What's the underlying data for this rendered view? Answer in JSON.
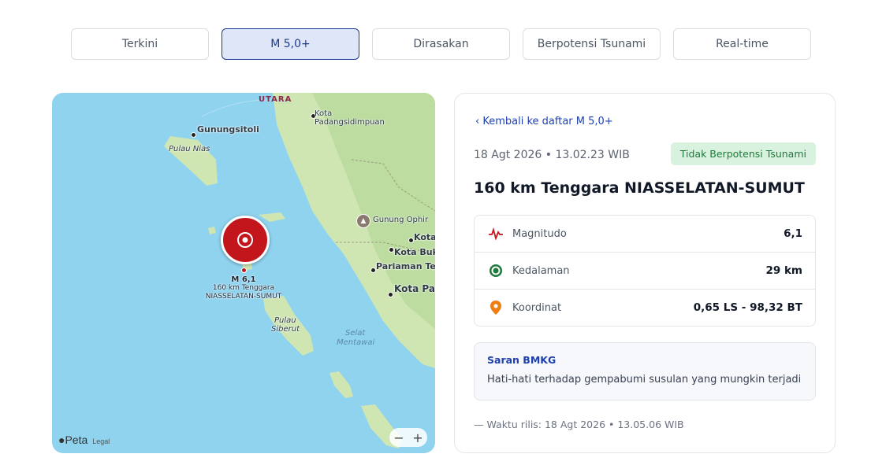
{
  "tabs": [
    {
      "label": "Terkini",
      "active": false
    },
    {
      "label": "M 5,0+",
      "active": true
    },
    {
      "label": "Dirasakan",
      "active": false
    },
    {
      "label": "Berpotensi Tsunami",
      "active": false
    },
    {
      "label": "Real-time",
      "active": false
    }
  ],
  "map": {
    "compass": "UTARA",
    "places": {
      "gunungsitoli": "Gunungsitoli",
      "pulau_nias": "Pulau Nias",
      "padangsidimpuan_1": "Kota",
      "padangsidimpuan_2": "Padangsidimpuan",
      "gunung_ophir": "Gunung Ophir",
      "kota": "Kota",
      "kota_buki": "Kota Buki",
      "pariaman": "Pariaman Teng",
      "kota_pad": "Kota Pad",
      "pulau_siberut_1": "Pulau",
      "pulau_siberut_2": "Siberut",
      "selat_1": "Selat",
      "selat_2": "Mentawai"
    },
    "marker": {
      "magnitude_label": "M 6,1",
      "line1": "160 km Tenggara",
      "line2": "NIASSELATAN-SUMUT"
    },
    "brand": "Peta",
    "legal": "Legal",
    "zoom_out": "−",
    "zoom_in": "+"
  },
  "detail": {
    "back_label": "Kembali ke daftar M 5,0+",
    "datetime": "18 Agt 2026 • 13.02.23 WIB",
    "tsunami_badge": "Tidak Berpotensi Tsunami",
    "title": "160 km Tenggara NIASSELATAN-SUMUT",
    "rows": [
      {
        "icon": "waveform-icon",
        "label": "Magnitudo",
        "value": "6,1"
      },
      {
        "icon": "depth-target-icon",
        "label": "Kedalaman",
        "value": "29 km"
      },
      {
        "icon": "location-pin-icon",
        "label": "Koordinat",
        "value": "0,65 LS - 98,32 BT"
      }
    ],
    "advice_title": "Saran BMKG",
    "advice_text": "Hati-hati terhadap gempabumi susulan yang mungkin terjadi",
    "release": "— Waktu rilis: 18 Agt 2026 • 13.05.06 WIB"
  },
  "colors": {
    "accent": "#1e40af",
    "marker_red": "#c3161c",
    "badge_bg": "#d9f2df",
    "badge_text": "#1d7a3a",
    "sea": "#8fd3ef",
    "land": "#cfe6b2"
  }
}
